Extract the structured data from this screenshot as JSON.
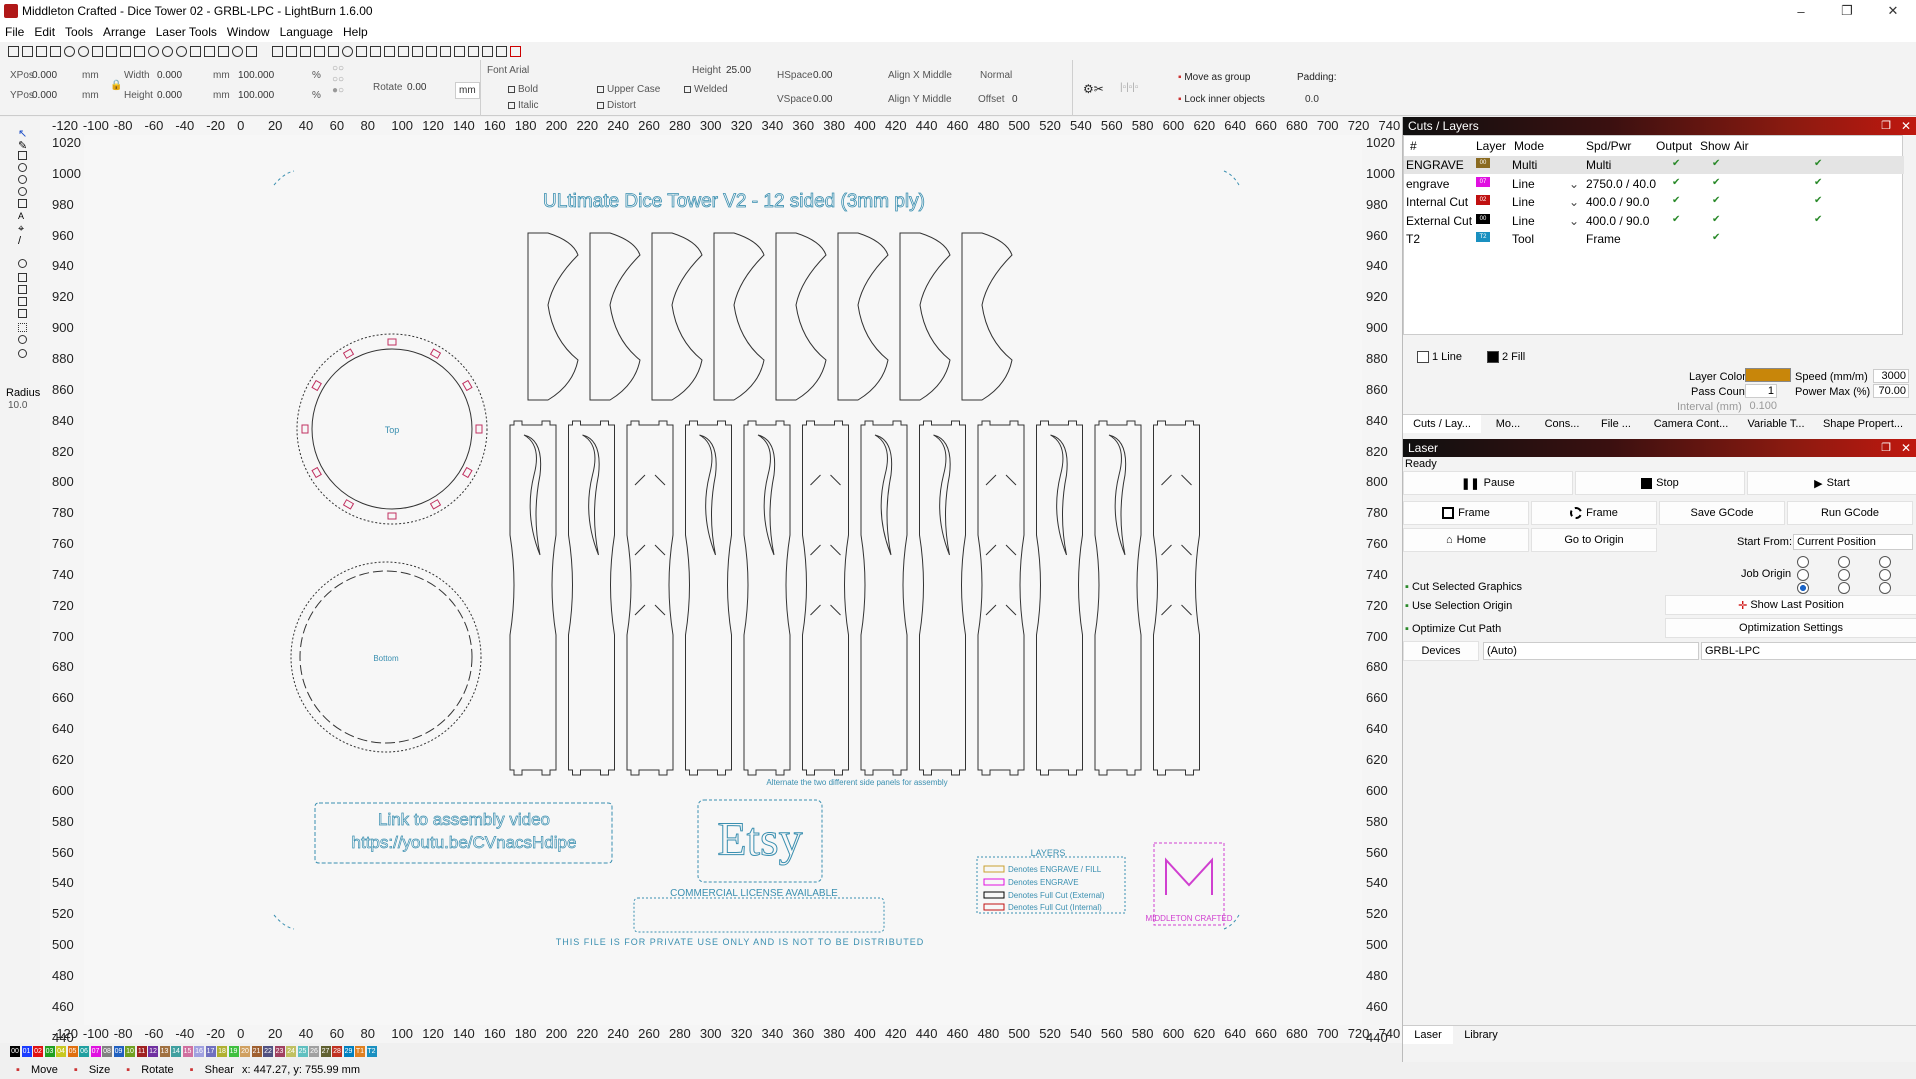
{
  "window": {
    "title": "Middleton Crafted - Dice Tower 02 - GRBL-LPC - LightBurn 1.6.00",
    "minimize": "–",
    "maximize": "❐",
    "close": "✕"
  },
  "menu": [
    "File",
    "Edit",
    "Tools",
    "Arrange",
    "Laser Tools",
    "Window",
    "Language",
    "Help"
  ],
  "props": {
    "xpos_label": "XPos",
    "xpos": "0.000",
    "ypos_label": "YPos",
    "ypos": "0.000",
    "width_label": "Width",
    "width": "0.000",
    "height_label": "Height",
    "height": "0.000",
    "unit_mm": "mm",
    "pct_w": "100.000",
    "pct_h": "100.000",
    "pct": "%",
    "rotate_label": "Rotate",
    "rotate": "0.00",
    "unit_btn": "mm",
    "font": "Font Arial",
    "font_height_label": "Height",
    "font_height": "25.00",
    "hspace_label": "HSpace",
    "hspace": "0.00",
    "vspace_label": "VSpace",
    "vspace": "0.00",
    "align_x": "Align X Middle",
    "align_y": "Align Y Middle",
    "normal": "Normal",
    "offset_label": "Offset",
    "offset": "0",
    "bold": "Bold",
    "italic": "Italic",
    "upper_case": "Upper Case",
    "distort": "Distort",
    "welded": "Welded",
    "move_as_group": "Move as group",
    "lock_inner": "Lock inner objects",
    "padding_label": "Padding:",
    "padding": "0.0"
  },
  "left_tools": {
    "radius_label": "Radius:",
    "radius": "10.0"
  },
  "rulers": {
    "x_ticks": [
      "-120",
      "-100",
      "-80",
      "-60",
      "-40",
      "-20",
      "0",
      "20",
      "40",
      "60",
      "80",
      "100",
      "120",
      "140",
      "160",
      "180",
      "200",
      "220",
      "240",
      "260",
      "280",
      "300",
      "320",
      "340",
      "360",
      "380",
      "400",
      "420",
      "440",
      "460",
      "480",
      "500",
      "520",
      "540",
      "560",
      "580",
      "600",
      "620",
      "640",
      "660",
      "680",
      "700",
      "720",
      "740"
    ],
    "y_ticks": [
      "1020",
      "1000",
      "980",
      "960",
      "940",
      "920",
      "900",
      "880",
      "860",
      "840",
      "820",
      "800",
      "780",
      "760",
      "740",
      "720",
      "700",
      "680",
      "660",
      "640",
      "620",
      "600",
      "580",
      "560",
      "540",
      "520",
      "500",
      "480",
      "460",
      "440"
    ]
  },
  "canvas": {
    "title": "ULtimate Dice Tower V2 - 12 sided (3mm ply)",
    "top_label": "Top",
    "bottom_label": "Bottom",
    "small_note": "Alternate the two different side panels for assembly",
    "link_line1": "Link to assembly video",
    "link_line2": "https://youtu.be/CVnacsHdipe",
    "etsy": "Etsy",
    "commercial_title": "COMMERCIAL LICENSE AVAILABLE",
    "footer_note": "THIS FILE IS FOR PRIVATE USE ONLY AND IS NOT TO BE DISTRIBUTED",
    "legend_title": "LAYERS",
    "legend": [
      "Denotes ENGRAVE / FILL",
      "Denotes ENGRAVE",
      "Denotes Full Cut (External)",
      "Denotes Full Cut (Internal)"
    ],
    "logo_text": "MIDDLETON CRAFTED"
  },
  "palette": [
    "00",
    "01",
    "02",
    "03",
    "04",
    "05",
    "06",
    "07",
    "08",
    "09",
    "10",
    "11",
    "12",
    "13",
    "14",
    "15",
    "16",
    "17",
    "18",
    "19",
    "20",
    "21",
    "22",
    "23",
    "24",
    "25",
    "26",
    "27",
    "28",
    "29",
    "T1",
    "T2"
  ],
  "palette_colors": [
    "#000000",
    "#1a3cff",
    "#e01010",
    "#20a020",
    "#c8c820",
    "#e07010",
    "#20a0a0",
    "#e010e0",
    "#808080",
    "#2060c0",
    "#70a020",
    "#a02020",
    "#7030a0",
    "#a07040",
    "#40a0a0",
    "#d070a0",
    "#a0a0e0",
    "#7070c0",
    "#b0b030",
    "#40c040",
    "#d0a060",
    "#a06030",
    "#505080",
    "#a04060",
    "#c0c060",
    "#60c0c0",
    "#a0a0a0",
    "#606030",
    "#c03020",
    "#0080c0",
    "#e08020",
    "#1a90c0"
  ],
  "status": {
    "move": "Move",
    "size": "Size",
    "rotate": "Rotate",
    "shear": "Shear",
    "coords": "x: 447.27, y: 755.99 mm"
  },
  "cuts": {
    "title": "Cuts / Layers",
    "headers": [
      "#",
      "Layer",
      "Mode",
      "Spd/Pwr",
      "Output",
      "Show",
      "Air"
    ],
    "rows": [
      {
        "name": "ENGRAVE",
        "color": "#8a6a20",
        "num": "00",
        "mode": "Multi",
        "spd": "Multi"
      },
      {
        "name": "engrave",
        "color": "#e010e0",
        "num": "07",
        "mode": "Line",
        "spd": "2750.0 / 40.0"
      },
      {
        "name": "Internal Cut",
        "color": "#c01010",
        "num": "02",
        "mode": "Line",
        "spd": "400.0 / 90.0"
      },
      {
        "name": "External Cut",
        "color": "#000000",
        "num": "00",
        "mode": "Line",
        "spd": "400.0 / 90.0"
      },
      {
        "name": "T2",
        "color": "#1a90c0",
        "num": "T2",
        "mode": "Tool",
        "spd": "Frame"
      }
    ],
    "line_tab": "1 Line",
    "fill_tab": "2 Fill",
    "layer_color": "Layer Color",
    "speed_label": "Speed (mm/m)",
    "speed": "3000",
    "pass_label": "Pass Count",
    "pass": "1",
    "power_label": "Power Max (%)",
    "power": "70.00",
    "interval_label": "Interval (mm)",
    "interval": "0.100",
    "tabs": [
      "Cuts / Lay...",
      "Mo...",
      "Cons...",
      "File ...",
      "Camera Cont...",
      "Variable T...",
      "Shape Propert..."
    ]
  },
  "laser": {
    "title": "Laser",
    "status": "Ready",
    "pause": "Pause",
    "stop": "Stop",
    "start": "Start",
    "frame1": "Frame",
    "frame2": "Frame",
    "save_gcode": "Save GCode",
    "run_gcode": "Run GCode",
    "home": "Home",
    "go_origin": "Go to Origin",
    "start_from_label": "Start From:",
    "start_from": "Current Position",
    "job_origin": "Job Origin",
    "cut_selected": "Cut Selected Graphics",
    "use_selection": "Use Selection Origin",
    "show_last": "Show Last Position",
    "optimize": "Optimize Cut Path",
    "opt_settings": "Optimization Settings",
    "devices": "Devices",
    "auto": "(Auto)",
    "device": "GRBL-LPC",
    "bottom_tabs": [
      "Laser",
      "Library"
    ]
  }
}
